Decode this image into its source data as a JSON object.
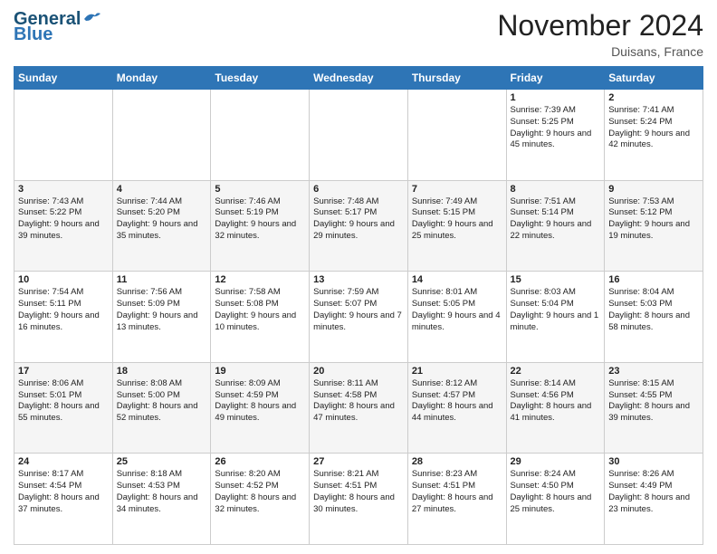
{
  "header": {
    "logo_line1": "General",
    "logo_line2": "Blue",
    "month": "November 2024",
    "location": "Duisans, France"
  },
  "weekdays": [
    "Sunday",
    "Monday",
    "Tuesday",
    "Wednesday",
    "Thursday",
    "Friday",
    "Saturday"
  ],
  "weeks": [
    [
      {
        "day": "",
        "info": ""
      },
      {
        "day": "",
        "info": ""
      },
      {
        "day": "",
        "info": ""
      },
      {
        "day": "",
        "info": ""
      },
      {
        "day": "",
        "info": ""
      },
      {
        "day": "1",
        "info": "Sunrise: 7:39 AM\nSunset: 5:25 PM\nDaylight: 9 hours and 45 minutes."
      },
      {
        "day": "2",
        "info": "Sunrise: 7:41 AM\nSunset: 5:24 PM\nDaylight: 9 hours and 42 minutes."
      }
    ],
    [
      {
        "day": "3",
        "info": "Sunrise: 7:43 AM\nSunset: 5:22 PM\nDaylight: 9 hours and 39 minutes."
      },
      {
        "day": "4",
        "info": "Sunrise: 7:44 AM\nSunset: 5:20 PM\nDaylight: 9 hours and 35 minutes."
      },
      {
        "day": "5",
        "info": "Sunrise: 7:46 AM\nSunset: 5:19 PM\nDaylight: 9 hours and 32 minutes."
      },
      {
        "day": "6",
        "info": "Sunrise: 7:48 AM\nSunset: 5:17 PM\nDaylight: 9 hours and 29 minutes."
      },
      {
        "day": "7",
        "info": "Sunrise: 7:49 AM\nSunset: 5:15 PM\nDaylight: 9 hours and 25 minutes."
      },
      {
        "day": "8",
        "info": "Sunrise: 7:51 AM\nSunset: 5:14 PM\nDaylight: 9 hours and 22 minutes."
      },
      {
        "day": "9",
        "info": "Sunrise: 7:53 AM\nSunset: 5:12 PM\nDaylight: 9 hours and 19 minutes."
      }
    ],
    [
      {
        "day": "10",
        "info": "Sunrise: 7:54 AM\nSunset: 5:11 PM\nDaylight: 9 hours and 16 minutes."
      },
      {
        "day": "11",
        "info": "Sunrise: 7:56 AM\nSunset: 5:09 PM\nDaylight: 9 hours and 13 minutes."
      },
      {
        "day": "12",
        "info": "Sunrise: 7:58 AM\nSunset: 5:08 PM\nDaylight: 9 hours and 10 minutes."
      },
      {
        "day": "13",
        "info": "Sunrise: 7:59 AM\nSunset: 5:07 PM\nDaylight: 9 hours and 7 minutes."
      },
      {
        "day": "14",
        "info": "Sunrise: 8:01 AM\nSunset: 5:05 PM\nDaylight: 9 hours and 4 minutes."
      },
      {
        "day": "15",
        "info": "Sunrise: 8:03 AM\nSunset: 5:04 PM\nDaylight: 9 hours and 1 minute."
      },
      {
        "day": "16",
        "info": "Sunrise: 8:04 AM\nSunset: 5:03 PM\nDaylight: 8 hours and 58 minutes."
      }
    ],
    [
      {
        "day": "17",
        "info": "Sunrise: 8:06 AM\nSunset: 5:01 PM\nDaylight: 8 hours and 55 minutes."
      },
      {
        "day": "18",
        "info": "Sunrise: 8:08 AM\nSunset: 5:00 PM\nDaylight: 8 hours and 52 minutes."
      },
      {
        "day": "19",
        "info": "Sunrise: 8:09 AM\nSunset: 4:59 PM\nDaylight: 8 hours and 49 minutes."
      },
      {
        "day": "20",
        "info": "Sunrise: 8:11 AM\nSunset: 4:58 PM\nDaylight: 8 hours and 47 minutes."
      },
      {
        "day": "21",
        "info": "Sunrise: 8:12 AM\nSunset: 4:57 PM\nDaylight: 8 hours and 44 minutes."
      },
      {
        "day": "22",
        "info": "Sunrise: 8:14 AM\nSunset: 4:56 PM\nDaylight: 8 hours and 41 minutes."
      },
      {
        "day": "23",
        "info": "Sunrise: 8:15 AM\nSunset: 4:55 PM\nDaylight: 8 hours and 39 minutes."
      }
    ],
    [
      {
        "day": "24",
        "info": "Sunrise: 8:17 AM\nSunset: 4:54 PM\nDaylight: 8 hours and 37 minutes."
      },
      {
        "day": "25",
        "info": "Sunrise: 8:18 AM\nSunset: 4:53 PM\nDaylight: 8 hours and 34 minutes."
      },
      {
        "day": "26",
        "info": "Sunrise: 8:20 AM\nSunset: 4:52 PM\nDaylight: 8 hours and 32 minutes."
      },
      {
        "day": "27",
        "info": "Sunrise: 8:21 AM\nSunset: 4:51 PM\nDaylight: 8 hours and 30 minutes."
      },
      {
        "day": "28",
        "info": "Sunrise: 8:23 AM\nSunset: 4:51 PM\nDaylight: 8 hours and 27 minutes."
      },
      {
        "day": "29",
        "info": "Sunrise: 8:24 AM\nSunset: 4:50 PM\nDaylight: 8 hours and 25 minutes."
      },
      {
        "day": "30",
        "info": "Sunrise: 8:26 AM\nSunset: 4:49 PM\nDaylight: 8 hours and 23 minutes."
      }
    ]
  ]
}
